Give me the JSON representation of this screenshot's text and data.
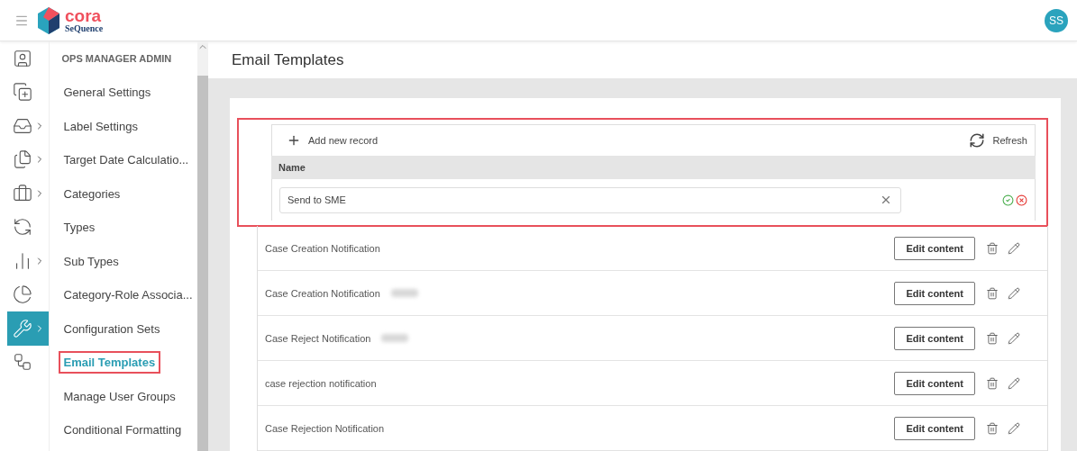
{
  "header": {
    "logo_word": "cora",
    "logo_sub": "SeQuence",
    "avatar": "SS"
  },
  "rail": [
    {
      "has_submenu": false,
      "selected": false
    },
    {
      "has_submenu": false,
      "selected": false
    },
    {
      "has_submenu": true,
      "selected": false
    },
    {
      "has_submenu": true,
      "selected": false
    },
    {
      "has_submenu": true,
      "selected": false
    },
    {
      "has_submenu": false,
      "selected": false
    },
    {
      "has_submenu": true,
      "selected": false
    },
    {
      "has_submenu": false,
      "selected": false
    },
    {
      "has_submenu": true,
      "selected": true
    },
    {
      "has_submenu": false,
      "selected": false
    }
  ],
  "nav": {
    "heading": "OPS MANAGER ADMIN",
    "items": [
      {
        "label": "General Settings",
        "selected": false,
        "highlighted": false
      },
      {
        "label": "Label Settings",
        "selected": false,
        "highlighted": false
      },
      {
        "label": "Target Date Calculatio...",
        "selected": false,
        "highlighted": false
      },
      {
        "label": "Categories",
        "selected": false,
        "highlighted": false
      },
      {
        "label": "Types",
        "selected": false,
        "highlighted": false
      },
      {
        "label": "Sub Types",
        "selected": false,
        "highlighted": false
      },
      {
        "label": "Category-Role Associa...",
        "selected": false,
        "highlighted": false
      },
      {
        "label": "Configuration Sets",
        "selected": false,
        "highlighted": false
      },
      {
        "label": "Email Templates",
        "selected": true,
        "highlighted": true
      },
      {
        "label": "Manage User Groups",
        "selected": false,
        "highlighted": false
      },
      {
        "label": "Conditional Formatting",
        "selected": false,
        "highlighted": false
      }
    ]
  },
  "page_title": "Email Templates",
  "grid": {
    "highlighted": true,
    "add_label": "Add new record",
    "refresh_label": "Refresh",
    "column": "Name",
    "edit_row": {
      "value": "Send to SME"
    },
    "rows": [
      {
        "name": "Case Creation Notification",
        "redacted": false,
        "button": "Edit content"
      },
      {
        "name": "Case Creation Notification",
        "redacted": true,
        "button": "Edit content"
      },
      {
        "name": "Case Reject Notification",
        "redacted": true,
        "button": "Edit content"
      },
      {
        "name": "case rejection notification",
        "redacted": false,
        "button": "Edit content"
      },
      {
        "name": "Case Rejection Notification",
        "redacted": false,
        "button": "Edit content"
      }
    ]
  }
}
